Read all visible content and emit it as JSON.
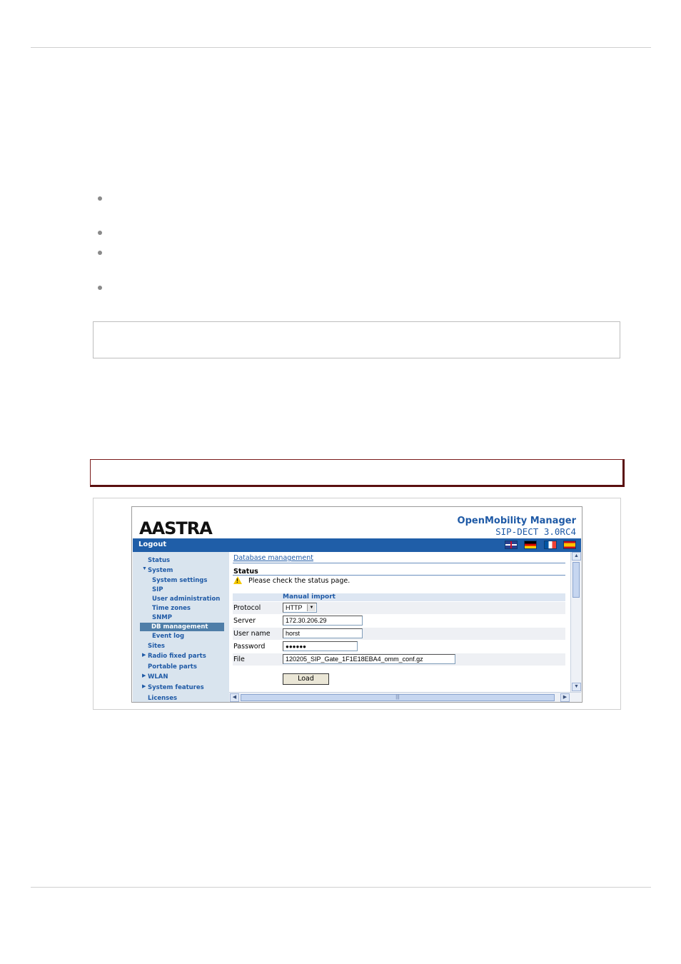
{
  "header": {
    "app_name": "OpenMobility Manager",
    "version": "SIP-DECT 3.0RC4",
    "logo": "AASTRA"
  },
  "topbar": {
    "logout": "Logout",
    "flags": [
      "flag-uk-icon",
      "flag-de-icon",
      "flag-fr-icon",
      "flag-es-icon"
    ]
  },
  "sidebar": {
    "items": [
      {
        "label": "Status"
      },
      {
        "label": "System",
        "expanded": true
      },
      {
        "label": "System settings"
      },
      {
        "label": "SIP"
      },
      {
        "label": "User administration"
      },
      {
        "label": "Time zones"
      },
      {
        "label": "SNMP"
      },
      {
        "label": "DB management",
        "selected": true
      },
      {
        "label": "Event log"
      },
      {
        "label": "Sites"
      },
      {
        "label": "Radio fixed parts",
        "collapsed": true
      },
      {
        "label": "Portable parts"
      },
      {
        "label": "WLAN",
        "collapsed": true
      },
      {
        "label": "System features",
        "collapsed": true
      },
      {
        "label": "Licenses"
      }
    ]
  },
  "main": {
    "page_title": "Database management",
    "status_heading": "Status",
    "status_message": "Please check the status page.",
    "section_title": "Manual import",
    "fields": {
      "protocol": {
        "label": "Protocol",
        "value": "HTTP"
      },
      "server": {
        "label": "Server",
        "value": "172.30.206.29"
      },
      "username": {
        "label": "User name",
        "value": "horst"
      },
      "password": {
        "label": "Password",
        "value": "●●●●●●"
      },
      "file": {
        "label": "File",
        "value": "120205_SIP_Gate_1F1E18EBA4_omm_conf.gz"
      }
    },
    "load_button": "Load"
  }
}
